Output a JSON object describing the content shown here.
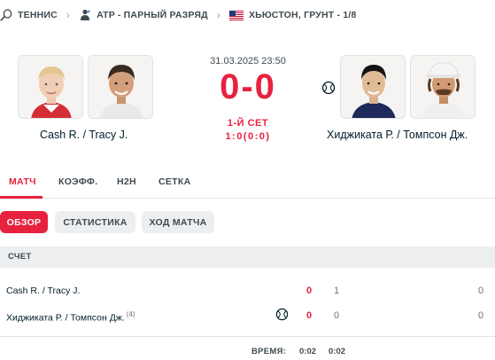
{
  "breadcrumb": {
    "sport": "ТЕННИС",
    "tournament_type": "ATP - ПАРНЫЙ РАЗРЯД",
    "tournament": "ХЬЮСТОН, ГРУНТ - 1/8",
    "icons": [
      "tennis-racket-icon",
      "chevron-right-icon",
      "atp-doubles-icon",
      "chevron-right-icon",
      "us-flag-icon"
    ]
  },
  "match": {
    "datetime": "31.03.2025 23:50",
    "score": "0-0",
    "status": "1-Й СЕТ",
    "set_score": "1:0(0:0)",
    "home_team": "Cash R. / Tracy J.",
    "away_team": "Хиджиката Р. / Томпсон Дж.",
    "serving": "away"
  },
  "tabs": [
    {
      "label": "МАТЧ",
      "active": true
    },
    {
      "label": "КОЭФФ.",
      "active": false
    },
    {
      "label": "H2H",
      "active": false
    },
    {
      "label": "СЕТКА",
      "active": false
    }
  ],
  "subtabs": [
    {
      "label": "ОБЗОР",
      "active": true
    },
    {
      "label": "СТАТИСТИКА",
      "active": false
    },
    {
      "label": "ХОД МАТЧА",
      "active": false
    }
  ],
  "scoreboard": {
    "header": "СЧЕТ",
    "rows": [
      {
        "name": "Cash R. / Tracy J.",
        "seed": "",
        "serving": false,
        "total": "0",
        "set1": "1",
        "game": "0"
      },
      {
        "name": "Хиджиката Р. / Томпсон Дж.",
        "seed": "(4)",
        "serving": true,
        "total": "0",
        "set1": "0",
        "game": "0"
      }
    ],
    "time_label": "ВРЕМЯ:",
    "total_time": "0:02",
    "set1_time": "0:02"
  },
  "colors": {
    "accent": "#e8213f",
    "text": "#001e28",
    "muted": "#3f4a50",
    "pill_bg": "#eceeef"
  }
}
